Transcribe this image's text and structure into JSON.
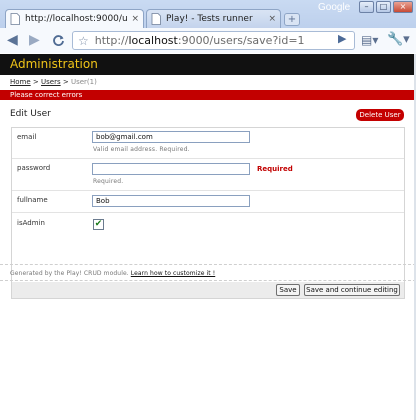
{
  "browser": {
    "brand": "Google",
    "tabs": [
      {
        "title": "http://localhost:9000/user...",
        "close": "×",
        "active": true
      },
      {
        "title": "Play! - Tests runner",
        "close": "×",
        "active": false
      }
    ],
    "new_tab": "+",
    "window_buttons": {
      "minimize": "–",
      "maximize": "□",
      "close": "×"
    },
    "url_host": "localhost",
    "url_prefix": "http://",
    "url_rest": ":9000/users/save?id=1"
  },
  "app": {
    "header": "Administration",
    "breadcrumb": {
      "home": "Home",
      "users": "Users",
      "current": "User(1)",
      "separator": ">"
    },
    "error_message": "Please correct errors",
    "edit_title": "Edit User",
    "delete_label": "Delete User"
  },
  "form": {
    "email": {
      "label": "email",
      "value": "bob@gmail.com",
      "help": "Valid email address. Required."
    },
    "password": {
      "label": "password",
      "value": "",
      "help": "Required.",
      "error": "Required"
    },
    "fullname": {
      "label": "fullname",
      "value": "Bob"
    },
    "isAdmin": {
      "label": "isAdmin",
      "checked": true,
      "mark": "✔"
    },
    "save_label": "Save",
    "save_continue_label": "Save and continue editing"
  },
  "footer": {
    "text": "Generated by the Play! CRUD module.",
    "link": "Learn how to customize it !"
  }
}
